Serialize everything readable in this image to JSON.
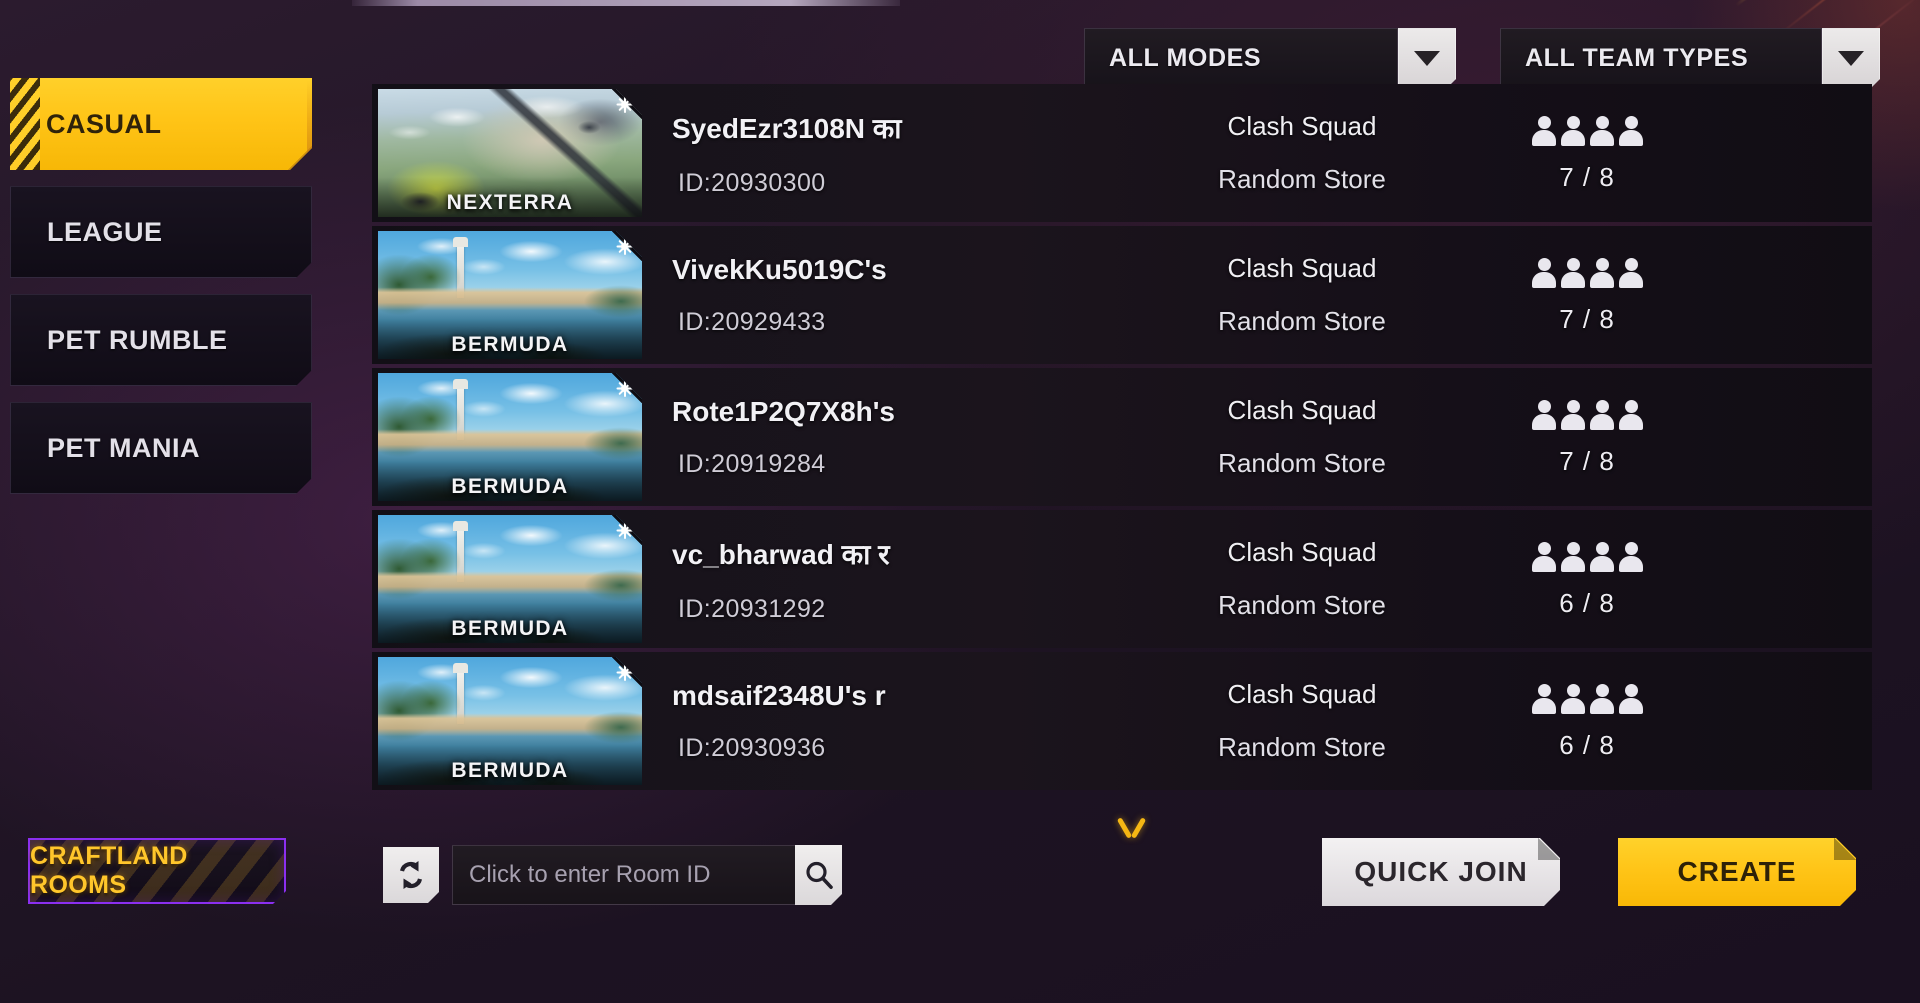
{
  "sidebar": {
    "tabs": [
      {
        "label": "CASUAL",
        "active": true
      },
      {
        "label": "LEAGUE",
        "active": false
      },
      {
        "label": "PET RUMBLE",
        "active": false
      },
      {
        "label": "PET MANIA",
        "active": false
      }
    ],
    "craftland_label": "CRAFTLAND ROOMS"
  },
  "filters": {
    "mode": {
      "value": "ALL MODES"
    },
    "team": {
      "value": "ALL TEAM TYPES"
    }
  },
  "rooms": [
    {
      "map": "NEXTERRA",
      "map_art": "nexterra",
      "title": "SyedEzr3108N का",
      "id": "ID:20930300",
      "mode": "Clash Squad",
      "submode": "Random Store",
      "players": "7 / 8",
      "icon_count": 4
    },
    {
      "map": "BERMUDA",
      "map_art": "bermuda",
      "title": "VivekKu5019C's",
      "id": "ID:20929433",
      "mode": "Clash Squad",
      "submode": "Random Store",
      "players": "7 / 8",
      "icon_count": 4
    },
    {
      "map": "BERMUDA",
      "map_art": "bermuda",
      "title": "Rote1P2Q7X8h's",
      "id": "ID:20919284",
      "mode": "Clash Squad",
      "submode": "Random Store",
      "players": "7 / 8",
      "icon_count": 4
    },
    {
      "map": "BERMUDA",
      "map_art": "bermuda",
      "title": "vc_bharwad का र",
      "id": "ID:20931292",
      "mode": "Clash Squad",
      "submode": "Random Store",
      "players": "6 / 8",
      "icon_count": 4
    },
    {
      "map": "BERMUDA",
      "map_art": "bermuda",
      "title": "mdsaif2348U's r",
      "id": "ID:20930936",
      "mode": "Clash Squad",
      "submode": "Random Store",
      "players": "6 / 8",
      "icon_count": 4
    }
  ],
  "bottom": {
    "room_id_placeholder": "Click to enter Room ID",
    "room_id_value": "",
    "quick_join_label": "QUICK JOIN",
    "create_label": "CREATE"
  },
  "colors": {
    "accent_yellow": "#ffc417",
    "craftland_purple": "#8b2ff0",
    "panel_dark": "#15101a",
    "text_light": "#f2f1f5"
  }
}
